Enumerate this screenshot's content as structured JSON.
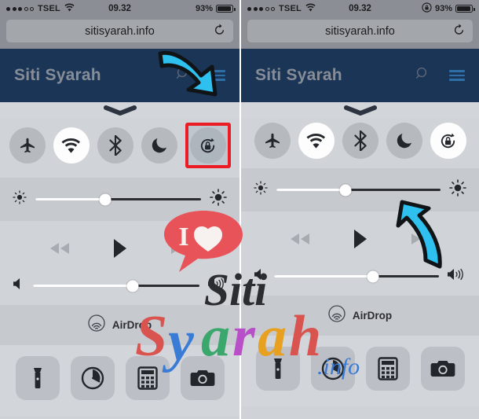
{
  "status_bar": {
    "signal_dots_filled": 3,
    "signal_dots_hollow": 2,
    "carrier": "TSEL",
    "wifi_icon": "wifi-icon",
    "time": "09.32",
    "battery_percent": "93%",
    "battery_level": 93,
    "rotation_lock_indicator": "rotation-lock-indicator-icon"
  },
  "browser": {
    "url": "sitisyarah.info",
    "reload_icon": "reload-icon"
  },
  "site_header": {
    "title": "Siti Syarah",
    "search_icon": "search-icon",
    "menu_icon": "hamburger-menu-icon"
  },
  "control_center": {
    "handle_icon": "chevron-down-handle-icon",
    "toggles": [
      {
        "name": "airplane-mode",
        "icon": "airplane-icon",
        "active": false,
        "highlighted": false
      },
      {
        "name": "wifi",
        "icon": "wifi-icon",
        "active": true,
        "highlighted": false
      },
      {
        "name": "bluetooth",
        "icon": "bluetooth-icon",
        "active": false,
        "highlighted": false
      },
      {
        "name": "do-not-disturb",
        "icon": "moon-icon",
        "active": false,
        "highlighted": false
      },
      {
        "name": "rotation-lock",
        "icon": "rotation-lock-icon",
        "active": false,
        "highlighted": true
      }
    ],
    "toggles_after": [
      {
        "name": "airplane-mode",
        "icon": "airplane-icon",
        "active": false,
        "highlighted": false
      },
      {
        "name": "wifi",
        "icon": "wifi-icon",
        "active": true,
        "highlighted": false
      },
      {
        "name": "bluetooth",
        "icon": "bluetooth-icon",
        "active": false,
        "highlighted": false
      },
      {
        "name": "do-not-disturb",
        "icon": "moon-icon",
        "active": false,
        "highlighted": false
      },
      {
        "name": "rotation-lock",
        "icon": "rotation-lock-icon",
        "active": true,
        "highlighted": false
      }
    ],
    "brightness": {
      "value": 42,
      "low_icon": "brightness-low-icon",
      "high_icon": "brightness-high-icon"
    },
    "media": {
      "rewind_icon": "rewind-icon",
      "play_icon": "play-icon",
      "forward_icon": "fast-forward-icon"
    },
    "volume": {
      "value": 60,
      "mute_icon": "volume-low-icon",
      "max_icon": "volume-high-icon"
    },
    "airdrop": {
      "label": "AirDrop",
      "icon": "airdrop-icon"
    },
    "apps": [
      {
        "name": "flashlight",
        "icon": "flashlight-icon"
      },
      {
        "name": "timer",
        "icon": "timer-icon"
      },
      {
        "name": "calculator",
        "icon": "calculator-icon"
      },
      {
        "name": "camera",
        "icon": "camera-icon"
      }
    ]
  },
  "annotations": {
    "arrow_left": {
      "name": "pointer-arrow-down-right",
      "color": "#2ec0ee"
    },
    "arrow_right": {
      "name": "pointer-arrow-up-left",
      "color": "#2ec0ee"
    }
  },
  "watermark": {
    "bubble_text": "I",
    "bubble_icon": "heart-icon",
    "bubble_color": "#e8535a",
    "script_word": "Siti",
    "letters": [
      {
        "char": "S",
        "color": "#d9534f"
      },
      {
        "char": "y",
        "color": "#3a7bd5"
      },
      {
        "char": "a",
        "color": "#3aa76d"
      },
      {
        "char": "r",
        "color": "#b84fc9"
      },
      {
        "char": "a",
        "color": "#e8a020"
      },
      {
        "char": "h",
        "color": "#d9534f"
      }
    ],
    "suffix": ".info",
    "suffix_color": "#3a7bd5"
  },
  "colors": {
    "header_navy": "#1b3557",
    "status_grey": "#8b8e94",
    "highlight_red": "#ec1c24",
    "arrow_cyan": "#2ec0ee"
  }
}
